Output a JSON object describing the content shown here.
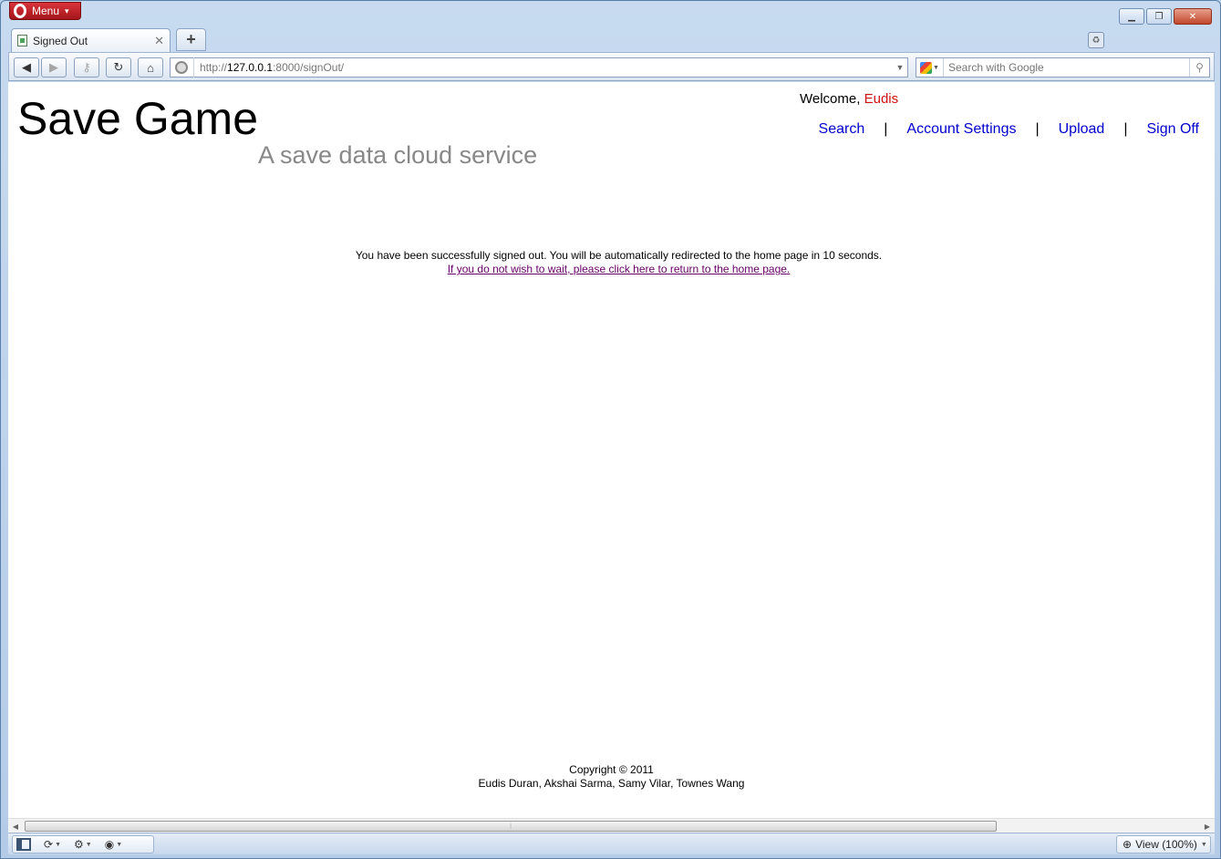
{
  "browser": {
    "menu_label": "Menu",
    "tab_title": "Signed Out",
    "url_scheme": "http://",
    "url_host": "127.0.0.1",
    "url_rest": ":8000/signOut/",
    "search_placeholder": "Search with Google",
    "zoom_label": "View (100%)"
  },
  "header": {
    "site_title": "Save Game",
    "site_subtitle": "A save data cloud service",
    "welcome_prefix": "Welcome,",
    "welcome_user": "Eudis",
    "nav": {
      "search": "Search",
      "account_settings": "Account Settings",
      "upload": "Upload",
      "sign_off": "Sign Off",
      "separator": "|"
    }
  },
  "main": {
    "signout_message": "You have been successfully signed out. You will be automatically redirected to the home page in 10 seconds.",
    "return_link": "If you do not wish to wait, please click here to return to the home page."
  },
  "footer": {
    "copyright": "Copyright © 2011",
    "authors": "Eudis Duran, Akshai Sarma, Samy Vilar, Townes Wang"
  },
  "colors": {
    "link": "#0000cc",
    "visited_link": "#660066",
    "welcome_user": "#d01010",
    "subtitle": "#888888"
  }
}
